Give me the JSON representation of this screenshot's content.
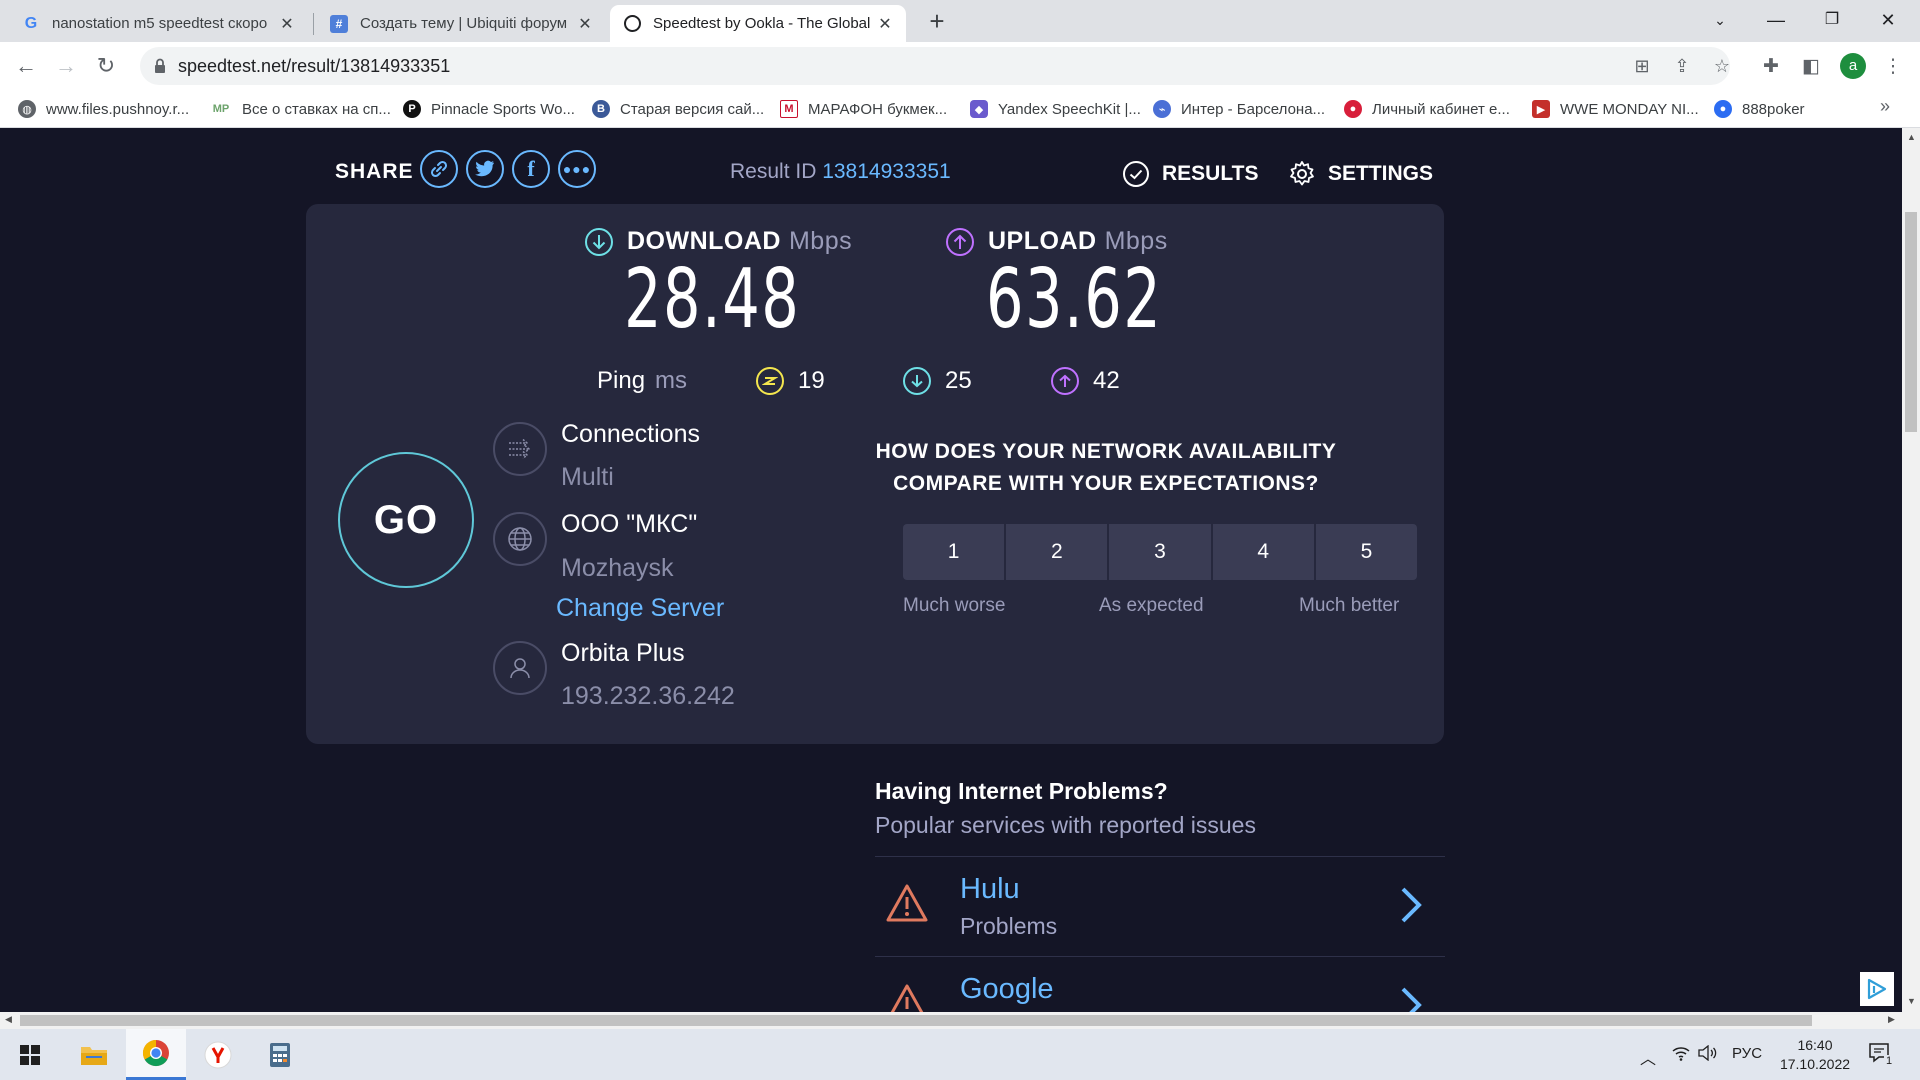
{
  "browser": {
    "tabs": [
      {
        "title": "nanostation m5 speedtest скоро",
        "favicon": "google-g-icon"
      },
      {
        "title": "Создать тему | Ubiquiti форум U",
        "favicon": "ubiquiti-icon"
      },
      {
        "title": "Speedtest by Ookla - The Global",
        "favicon": "speedtest-icon",
        "active": true
      }
    ],
    "url": "speedtest.net/result/13814933351",
    "profile_initial": "a",
    "bookmarks": [
      "www.files.pushnoy.r...",
      "Все о ставках на сп...",
      "Pinnacle Sports Wo...",
      "Старая версия сай...",
      "МАРАФОН букмек...",
      "Yandex SpeechKit |...",
      "Интер - Барселона...",
      "Личный кабинет е...",
      "WWE MONDAY NI...",
      "888poker"
    ],
    "bookmark_icons": {
      "mp": "MP",
      "pinnacle": "P",
      "marafon": "M"
    }
  },
  "header": {
    "share_label": "SHARE",
    "result_label": "Result ID",
    "result_id": "13814933351",
    "results_label": "RESULTS",
    "settings_label": "SETTINGS"
  },
  "metrics": {
    "download_label": "DOWNLOAD",
    "upload_label": "UPLOAD",
    "unit": "Mbps",
    "download_value": "28.48",
    "upload_value": "63.62",
    "ping_label": "Ping",
    "ping_unit": "ms",
    "ping_idle": "19",
    "ping_download": "25",
    "ping_upload": "42"
  },
  "go_label": "GO",
  "server": {
    "connections_label": "Connections",
    "connections_value": "Multi",
    "host_name": "ООО \"МКС\"",
    "host_location": "Mozhaysk",
    "change_server": "Change Server",
    "isp_name": "Orbita Plus",
    "isp_ip": "193.232.36.242"
  },
  "survey": {
    "question": "HOW DOES YOUR NETWORK AVAILABILITY COMPARE WITH YOUR EXPECTATIONS?",
    "options": [
      "1",
      "2",
      "3",
      "4",
      "5"
    ],
    "low_label": "Much worse",
    "mid_label": "As expected",
    "high_label": "Much better"
  },
  "problems": {
    "title": "Having Internet Problems?",
    "subtitle": "Popular services with reported issues",
    "items": [
      {
        "name": "Hulu",
        "status": "Problems"
      },
      {
        "name": "Google",
        "status": ""
      }
    ]
  },
  "taskbar": {
    "language": "РУС",
    "time": "16:40",
    "date": "17.10.2022",
    "notification_count": "1"
  },
  "colors": {
    "page_bg": "#141526",
    "card_bg": "#26283d",
    "accent_blue": "#6ab9ff",
    "download_cyan": "#6ee0e6",
    "upload_purple": "#bf71ff",
    "ping_yellow": "#f4e64e",
    "warning_orange": "#e07a5f"
  }
}
